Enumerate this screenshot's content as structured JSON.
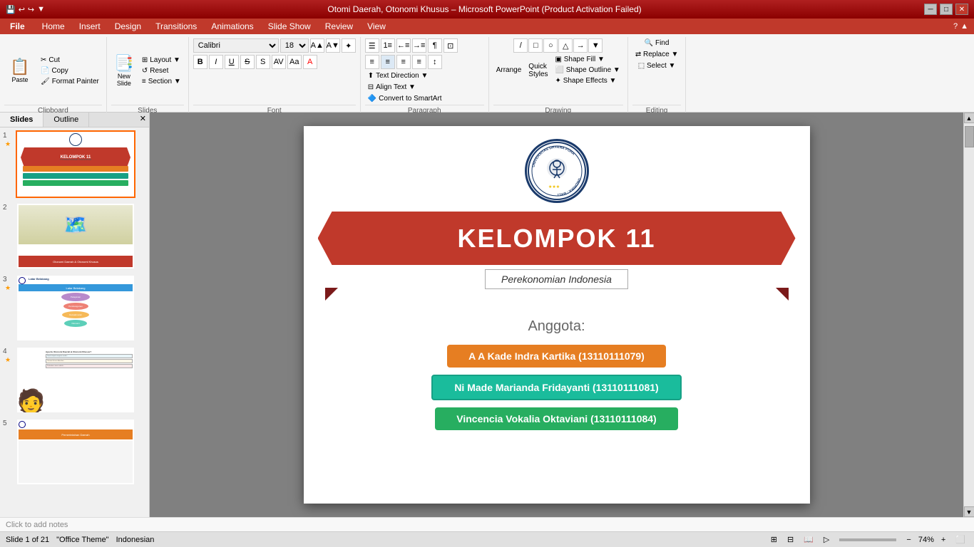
{
  "window": {
    "title": "Otomi Daerah, Otonomi Khusus – Microsoft PowerPoint (Product Activation Failed)",
    "quick_access_btns": [
      "save",
      "undo",
      "redo",
      "customize"
    ]
  },
  "menubar": {
    "file_label": "File",
    "items": [
      "Home",
      "Insert",
      "Design",
      "Transitions",
      "Animations",
      "Slide Show",
      "Review",
      "View"
    ]
  },
  "ribbon": {
    "active_tab": "Home",
    "groups": [
      {
        "name": "Clipboard",
        "buttons": [
          {
            "id": "paste",
            "label": "Paste",
            "icon": "📋"
          },
          {
            "id": "cut",
            "label": "Cut",
            "icon": "✂"
          },
          {
            "id": "copy",
            "label": "Copy",
            "icon": "📄"
          },
          {
            "id": "format-painter",
            "label": "Format Painter",
            "icon": "🖌"
          }
        ]
      },
      {
        "name": "Slides",
        "buttons": [
          {
            "id": "new-slide",
            "label": "New Slide",
            "icon": "📑"
          },
          {
            "id": "layout",
            "label": "Layout"
          },
          {
            "id": "reset",
            "label": "Reset"
          },
          {
            "id": "section",
            "label": "Section"
          }
        ]
      },
      {
        "name": "Font",
        "font_name": "Calibri",
        "font_size": "18"
      },
      {
        "name": "Paragraph",
        "items": [
          "Text Direction",
          "Align Text",
          "Convert to SmartArt"
        ]
      },
      {
        "name": "Drawing",
        "items": [
          "Arrange",
          "Quick Styles",
          "Shape Fill",
          "Shape Outline",
          "Shape Effects"
        ]
      },
      {
        "name": "Editing",
        "items": [
          "Find",
          "Replace",
          "Select"
        ]
      }
    ]
  },
  "sidebar": {
    "tabs": [
      {
        "label": "Slides",
        "active": true
      },
      {
        "label": "Outline",
        "active": false
      }
    ],
    "slides": [
      {
        "num": 1,
        "selected": true,
        "starred": true
      },
      {
        "num": 2,
        "selected": false,
        "starred": false
      },
      {
        "num": 3,
        "selected": false,
        "starred": true
      },
      {
        "num": 4,
        "selected": false,
        "starred": true
      },
      {
        "num": 5,
        "selected": false,
        "starred": false
      }
    ]
  },
  "slide": {
    "logo_text": "UNIVERSITAS DHYANA PURA UNDHIRA-BALI",
    "heading": "KELOMPOK 11",
    "subheading": "Perekonomian Indonesia",
    "members_title": "Anggota:",
    "members": [
      {
        "name": "A A Kade Indra Kartika (13110111079)",
        "color": "orange"
      },
      {
        "name": "Ni Made Marianda Fridayanti (13110111081)",
        "color": "teal"
      },
      {
        "name": "Vincencia Vokalia Oktaviani (13110111084)",
        "color": "green"
      }
    ]
  },
  "status_bar": {
    "slide_info": "Slide 1 of 21",
    "theme": "\"Office Theme\"",
    "language": "Indonesian",
    "zoom": "74%",
    "notes_placeholder": "Click to add notes"
  }
}
